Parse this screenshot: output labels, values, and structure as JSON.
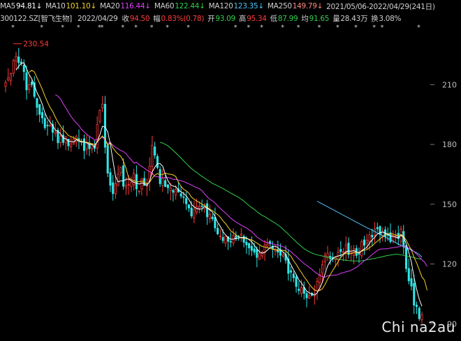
{
  "header": {
    "ma_items": [
      {
        "label": "MA5",
        "value": "94.81↓",
        "color": "#ffffff"
      },
      {
        "label": "MA10",
        "value": "101.10↓",
        "color": "#f5d12a"
      },
      {
        "label": "MA20",
        "value": "116.44↓",
        "color": "#e040fb"
      },
      {
        "label": "MA60",
        "value": "122.44↓",
        "color": "#2fd04a"
      },
      {
        "label": "MA120",
        "value": "123.35↓",
        "color": "#4fc3f7"
      },
      {
        "label": "MA250",
        "value": "149.79↓",
        "color": "#ff8a80"
      }
    ],
    "range": "2021/05/06-2022/04/29(241日)",
    "code": "300122.SZ[智飞生物]",
    "date": "2022/04/29",
    "quote": [
      {
        "label": "收",
        "value": "94.50",
        "color": "red"
      },
      {
        "label": "幅",
        "value": "0.83%(0.78)",
        "color": "red"
      },
      {
        "label": "开",
        "value": "93.09",
        "color": "green"
      },
      {
        "label": "高",
        "value": "95.34",
        "color": "red"
      },
      {
        "label": "低",
        "value": "87.99",
        "color": "green"
      },
      {
        "label": "均",
        "value": "91.65",
        "color": "green"
      },
      {
        "label": "量",
        "value": "28.43万",
        "color": "grey"
      },
      {
        "label": "换",
        "value": "3.08%",
        "color": "grey"
      }
    ]
  },
  "watermark": "Chi na2au",
  "high_marker": {
    "label": "230.54"
  },
  "chart_data": {
    "type": "candlestick",
    "y_ticks": [
      210,
      180,
      150,
      120,
      90
    ],
    "ylim": [
      88,
      235
    ],
    "n_points": 160,
    "close": [
      211.1,
      213.5,
      215.6,
      222.2,
      224.1,
      221.0,
      220.8,
      216.5,
      207.4,
      209.9,
      210.0,
      204.1,
      198.6,
      195.1,
      193.3,
      188.4,
      189.4,
      189.7,
      186.1,
      186.3,
      180.8,
      184.2,
      181.0,
      183.8,
      179.3,
      180.2,
      182.7,
      183.9,
      181.8,
      181.4,
      176.9,
      181.1,
      177.9,
      180.2,
      178.0,
      190.1,
      197.1,
      200.3,
      178.6,
      165.6,
      159.5,
      155.3,
      160.3,
      165.2,
      168.5,
      159.0,
      159.5,
      159.9,
      160.9,
      165.5,
      157.7,
      156.7,
      162.8,
      159.4,
      160.3,
      169.1,
      179.6,
      174.6,
      168.4,
      160.3,
      163.1,
      158.8,
      158.3,
      158.2,
      156.0,
      157.4,
      156.0,
      154.1,
      153.4,
      150.2,
      148.1,
      144.1,
      147.5,
      148.9,
      148.9,
      148.8,
      149.7,
      143.7,
      145.0,
      142.7,
      138.1,
      135.1,
      134.0,
      131.7,
      134.0,
      131.4,
      131.0,
      134.3,
      132.6,
      133.5,
      135.0,
      130.9,
      129.6,
      128.1,
      126.8,
      126.0,
      123.3,
      125.4,
      126.0,
      129.6,
      130.0,
      130.2,
      127.5,
      127.4,
      125.9,
      124.4,
      124.6,
      121.9,
      115.3,
      115.9,
      113.1,
      108.7,
      106.7,
      108.2,
      105.3,
      103.0,
      104.1,
      104.3,
      105.1,
      111.3,
      114.7,
      119.6,
      124.5,
      125.4,
      122.6,
      122.6,
      123.2,
      126.0,
      126.2,
      126.1,
      129.6,
      124.7,
      125.6,
      127.6,
      124.3,
      125.2,
      131.2,
      129.4,
      132.0,
      134.6,
      133.5,
      137.5,
      137.7,
      134.8,
      136.5,
      133.7,
      134.4,
      131.2,
      134.2,
      134.2,
      132.8,
      137.6,
      128.7,
      117.7,
      111.5,
      108.9,
      99.3,
      98.6,
      92.5,
      94.5
    ],
    "ma5": [
      null,
      null,
      null,
      null,
      217.3,
      219.3,
      220.7,
      221.0,
      218.0,
      215.1,
      212.9,
      209.6,
      206.0,
      203.5,
      200.2,
      195.9,
      193.0,
      191.2,
      189.4,
      187.2,
      186.6,
      185.4,
      183.3,
      182.8,
      181.6,
      181.5,
      181.2,
      182.4,
      181.6,
      181.2,
      181.3,
      180.8,
      180.1,
      179.9,
      178.8,
      181.5,
      184.7,
      189.1,
      188.8,
      186.4,
      180.3,
      171.9,
      163.9,
      161.2,
      161.7,
      161.7,
      162.5,
      162.6,
      161.8,
      160.9,
      160.7,
      160.1,
      160.7,
      160.3,
      159.4,
      161.6,
      166.2,
      168.6,
      170.4,
      170.4,
      169.1,
      165.0,
      161.8,
      159.7,
      159.1,
      158.8,
      157.2,
      156.3,
      155.4,
      154.2,
      152.4,
      150.0,
      148.7,
      147.8,
      147.5,
      147.6,
      148.8,
      148.0,
      147.2,
      146.0,
      143.8,
      140.9,
      138.9,
      136.3,
      134.6,
      133.2,
      132.4,
      132.5,
      132.7,
      133.0,
      133.3,
      133.3,
      133.1,
      132.2,
      131.1,
      129.4,
      127.6,
      126.1,
      125.4,
      125.8,
      126.9,
      128.2,
      128.7,
      129.0,
      128.2,
      127.1,
      126.0,
      124.8,
      121.8,
      119.6,
      117.0,
      114.7,
      112.0,
      110.5,
      108.4,
      106.4,
      105.5,
      104.9,
      104.4,
      105.5,
      107.9,
      110.9,
      115.0,
      119.1,
      121.4,
      122.9,
      123.7,
      124.0,
      124.4,
      124.8,
      126.2,
      126.5,
      126.4,
      126.7,
      126.1,
      125.5,
      126.6,
      127.5,
      128.4,
      130.5,
      132.1,
      133.4,
      135.1,
      135.6,
      136.0,
      135.6,
      135.0,
      134.1,
      133.9,
      133.5,
      133.0,
      134.4,
      133.5,
      130.2,
      125.7,
      120.9,
      113.2,
      107.2,
      102.2,
      98.8
    ],
    "ma10": [
      null,
      null,
      null,
      null,
      null,
      null,
      null,
      null,
      null,
      216.2,
      217.2,
      216.4,
      213.5,
      210.7,
      207.7,
      204.3,
      201.3,
      198.6,
      196.5,
      193.7,
      191.2,
      189.2,
      187.2,
      186.1,
      184.4,
      184.0,
      183.3,
      182.9,
      182.2,
      181.4,
      181.4,
      181.0,
      180.8,
      180.4,
      179.9,
      181.2,
      182.7,
      184.3,
      182.6,
      179.5,
      180.9,
      178.3,
      176.5,
      175.1,
      174.1,
      171.6,
      168.2,
      163.2,
      162.4,
      161.8,
      161.2,
      161.3,
      161.6,
      161.1,
      160.2,
      161.1,
      163.1,
      164.6,
      165.4,
      164.9,
      164.9,
      165.6,
      165.2,
      165.0,
      164.7,
      163.9,
      161.1,
      159.0,
      157.5,
      156.7,
      155.6,
      153.6,
      152.5,
      151.6,
      150.9,
      150.0,
      149.4,
      148.4,
      147.5,
      146.8,
      145.7,
      144.8,
      143.5,
      141.7,
      140.3,
      138.5,
      136.6,
      135.7,
      134.5,
      133.8,
      133.2,
      132.9,
      132.8,
      132.4,
      132.1,
      131.4,
      130.5,
      129.6,
      128.8,
      128.5,
      128.1,
      127.9,
      127.4,
      127.2,
      126.8,
      126.8,
      126.9,
      126.5,
      125.2,
      123.9,
      121.6,
      119.8,
      117.6,
      115.7,
      113.6,
      111.9,
      109.8,
      108.3,
      106.9,
      106.5,
      106.7,
      107.6,
      109.7,
      112.4,
      114.7,
      116.9,
      119.0,
      121.1,
      123.2,
      124.7,
      125.5,
      125.3,
      125.2,
      125.8,
      125.7,
      125.9,
      126.5,
      126.9,
      127.2,
      128.3,
      129.0,
      130.4,
      131.4,
      132.6,
      133.7,
      134.7,
      135.1,
      135.3,
      135.0,
      134.6,
      134.2,
      134.8,
      133.9,
      132.0,
      129.3,
      127.0,
      123.3,
      120.5,
      117.1,
      113.5,
      111.9,
      106.8
    ],
    "ma20": [
      null,
      null,
      null,
      null,
      null,
      null,
      null,
      null,
      null,
      null,
      null,
      null,
      null,
      null,
      null,
      null,
      null,
      null,
      null,
      205.0,
      204.2,
      202.8,
      200.4,
      198.4,
      196.1,
      194.1,
      192.3,
      190.8,
      189.4,
      187.6,
      186.3,
      185.1,
      184.0,
      183.3,
      182.1,
      182.6,
      183.0,
      183.6,
      182.4,
      180.5,
      181.1,
      179.6,
      178.6,
      177.7,
      177.0,
      176.4,
      175.4,
      173.7,
      172.3,
      170.6,
      171.1,
      169.8,
      169.1,
      168.1,
      167.1,
      166.3,
      165.6,
      163.9,
      163.9,
      163.4,
      163.1,
      163.4,
      163.4,
      163.1,
      162.4,
      162.5,
      162.1,
      161.8,
      161.4,
      160.8,
      160.2,
      159.6,
      158.9,
      158.3,
      157.8,
      156.9,
      155.2,
      153.7,
      152.5,
      151.7,
      150.6,
      149.2,
      147.9,
      146.7,
      145.6,
      144.3,
      143.0,
      142.0,
      141.0,
      140.3,
      139.4,
      138.8,
      138.1,
      137.1,
      136.2,
      135.0,
      133.5,
      132.7,
      131.7,
      131.2,
      130.7,
      130.4,
      130.1,
      129.8,
      129.5,
      129.1,
      128.7,
      128.0,
      127.0,
      126.2,
      124.9,
      123.9,
      122.5,
      121.4,
      120.2,
      119.3,
      118.3,
      117.4,
      116.1,
      115.2,
      114.3,
      113.7,
      113.4,
      114.1,
      114.2,
      114.4,
      114.4,
      114.7,
      115.4,
      115.6,
      116.1,
      116.4,
      116.8,
      117.6,
      118.3,
      119.4,
      120.5,
      121.6,
      122.5,
      123.6,
      124.7,
      125.8,
      126.8,
      127.4,
      127.6,
      127.6,
      127.7,
      128.0,
      128.2,
      128.4,
      128.6,
      129.0,
      129.0,
      128.5,
      128.0,
      127.4,
      126.2,
      125.0,
      123.6,
      122.1,
      121.0,
      118.7
    ],
    "ma60": [
      null,
      null,
      null,
      null,
      null,
      null,
      null,
      null,
      null,
      null,
      null,
      null,
      null,
      null,
      null,
      null,
      null,
      null,
      null,
      null,
      null,
      null,
      null,
      null,
      null,
      null,
      null,
      null,
      null,
      null,
      null,
      null,
      null,
      null,
      null,
      null,
      null,
      null,
      null,
      null,
      null,
      null,
      null,
      null,
      null,
      null,
      null,
      null,
      null,
      null,
      null,
      null,
      null,
      null,
      null,
      null,
      null,
      null,
      null,
      181.0,
      180.7,
      180.0,
      179.3,
      178.2,
      177.0,
      175.8,
      174.5,
      173.2,
      171.8,
      170.5,
      169.1,
      167.9,
      166.8,
      165.9,
      164.9,
      164.0,
      163.1,
      162.2,
      161.4,
      160.4,
      159.9,
      159.2,
      158.5,
      157.9,
      157.1,
      156.4,
      155.6,
      154.9,
      154.2,
      153.5,
      152.5,
      151.6,
      150.4,
      149.3,
      148.3,
      147.4,
      146.3,
      145.3,
      144.4,
      143.8,
      142.9,
      142.1,
      141.3,
      140.5,
      139.6,
      138.6,
      137.4,
      136.2,
      135.0,
      133.6,
      132.4,
      131.1,
      129.9,
      128.8,
      127.7,
      126.8,
      126.1,
      125.5,
      125.0,
      124.6,
      124.3,
      124.0,
      123.7,
      123.5,
      123.2,
      122.9,
      122.6,
      122.4,
      122.2,
      122.0,
      121.9,
      121.7,
      121.6,
      121.5,
      121.5,
      121.5,
      121.6,
      121.8,
      122.1,
      122.4,
      122.6,
      122.8,
      123.1,
      123.4,
      123.7,
      124.0,
      124.3,
      124.5,
      124.7,
      124.9,
      124.8,
      124.6,
      124.3,
      124.0,
      123.8,
      123.5,
      123.2,
      122.8,
      122.6,
      122.4
    ],
    "ma120": [
      null,
      null,
      null,
      null,
      null,
      null,
      null,
      null,
      null,
      null,
      null,
      null,
      null,
      null,
      null,
      null,
      null,
      null,
      null,
      null,
      null,
      null,
      null,
      null,
      null,
      null,
      null,
      null,
      null,
      null,
      null,
      null,
      null,
      null,
      null,
      null,
      null,
      null,
      null,
      null,
      null,
      null,
      null,
      null,
      null,
      null,
      null,
      null,
      null,
      null,
      null,
      null,
      null,
      null,
      null,
      null,
      null,
      null,
      null,
      null,
      null,
      null,
      null,
      null,
      null,
      null,
      null,
      null,
      null,
      null,
      null,
      null,
      null,
      null,
      null,
      null,
      null,
      null,
      null,
      null,
      null,
      null,
      null,
      null,
      null,
      null,
      null,
      null,
      null,
      null,
      null,
      null,
      null,
      null,
      null,
      null,
      null,
      null,
      null,
      null,
      null,
      null,
      null,
      null,
      null,
      null,
      null,
      null,
      null,
      null,
      null,
      null,
      null,
      null,
      null,
      null,
      null,
      null,
      null,
      151.5,
      150.8,
      150.1,
      149.4,
      148.7,
      148.0,
      147.3,
      146.6,
      145.9,
      145.2,
      144.5,
      143.8,
      143.1,
      142.4,
      141.7,
      141.0,
      140.3,
      139.6,
      138.9,
      138.2,
      137.6,
      137.0,
      136.3,
      135.6,
      134.9,
      134.2,
      133.5,
      132.8,
      132.1,
      131.4,
      130.7,
      130.0,
      129.3,
      128.6,
      128.0,
      127.5,
      126.9,
      126.3,
      125.6,
      124.8,
      123.4
    ],
    "ma250": [
      null,
      null,
      null,
      null,
      null,
      null,
      null,
      null,
      null,
      null,
      null,
      null,
      null,
      null,
      null,
      null,
      null,
      null,
      null,
      null,
      null,
      null,
      null,
      null,
      null,
      null,
      null,
      null,
      null,
      null,
      null,
      null,
      null,
      null,
      null,
      null,
      null,
      null,
      null,
      null,
      null,
      null,
      null,
      null,
      null,
      null,
      null,
      null,
      null,
      null,
      null,
      null,
      null,
      null,
      null,
      null,
      null,
      null,
      null,
      null,
      null,
      null,
      null,
      null,
      null,
      null,
      null,
      null,
      null,
      null,
      null,
      null,
      null,
      null,
      null,
      null,
      null,
      null,
      null,
      null,
      null,
      null,
      null,
      null,
      null,
      null,
      null,
      null,
      null,
      null,
      null,
      null,
      null,
      null,
      null,
      null,
      null,
      null,
      null,
      null,
      null,
      null,
      null,
      null,
      null,
      null,
      null,
      null,
      null,
      null,
      null,
      null,
      null,
      null,
      null,
      null,
      null,
      null,
      null,
      null,
      null,
      null,
      null,
      null,
      null,
      null,
      null,
      null,
      null,
      null,
      null,
      null,
      null,
      null,
      null,
      null,
      null,
      null,
      null,
      null,
      null,
      null,
      null,
      null,
      null,
      null,
      null,
      null,
      null,
      null,
      null,
      null,
      null,
      null,
      null,
      null,
      null,
      null,
      null,
      149.79
    ]
  }
}
